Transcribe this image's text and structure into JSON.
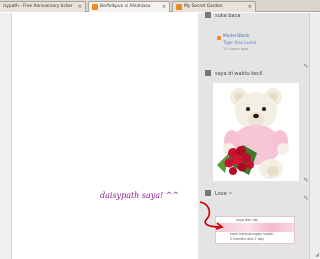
{
  "browser": {
    "tabs": [
      {
        "label": "isypath - Free Anniversary ticker",
        "favicon_color": "#d07a3a"
      },
      {
        "label": "Berfolkpun si Ahiahiasu",
        "favicon_color": "#f08a24"
      },
      {
        "label": "My Secret Garden",
        "favicon_color": "#f08a24"
      }
    ]
  },
  "sidebar": {
    "widget1": {
      "title": "suka baca",
      "feed_title": "Model Bibah",
      "feed_subtitle": "Tiger Alas Lantai",
      "feed_time": "12 hours ago"
    },
    "widget2": {
      "title": "saya di waktu kecil"
    },
    "widget3": {
      "title": "Love ~",
      "banner_top": "saya dan dia",
      "banner_line1": "kami berhubungan sudah",
      "banner_line2": "2 months and 1 day"
    }
  },
  "annotation": {
    "text": "daisypath saya! ^^",
    "color": "#8b1a8b",
    "arrow_color": "#cc0000"
  }
}
